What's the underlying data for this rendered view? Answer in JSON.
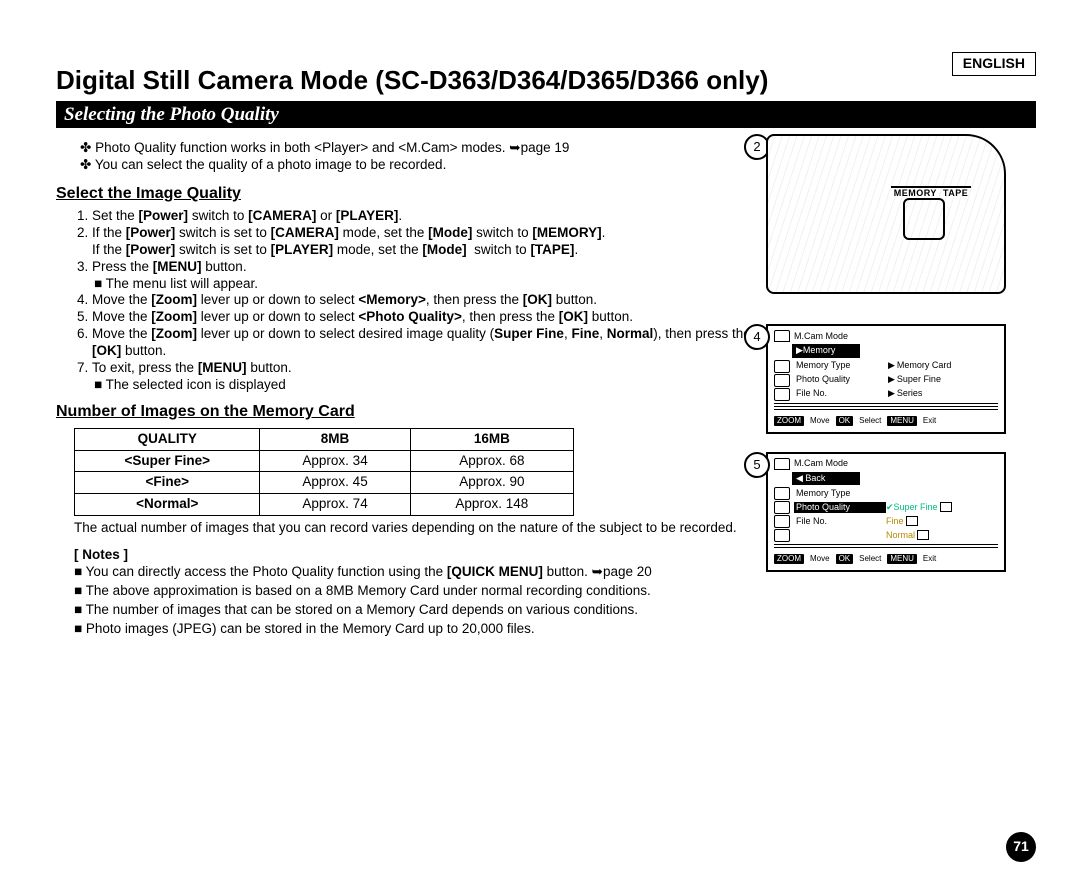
{
  "language_label": "ENGLISH",
  "title": "Digital Still Camera Mode (SC-D363/D364/D365/D366 only)",
  "section_bar": "Selecting the Photo Quality",
  "intro_bullets": [
    "Photo Quality function works in both <Player> and <M.Cam> modes. ➥page 19",
    "You can select the quality of a photo image to be recorded."
  ],
  "sub1_heading": "Select the Image Quality",
  "steps_html": [
    "Set the <b>[Power]</b> switch to <b>[CAMERA]</b> or <b>[PLAYER]</b>.",
    "If the <b>[Power]</b> switch is set to <b>[CAMERA]</b> mode, set the <b>[Mode]</b> switch to <b>[MEMORY]</b>.<br>If the <b>[Power]</b> switch is set to <b>[PLAYER]</b> mode, set the <b>[Mode]</b>&nbsp; switch to <b>[TAPE]</b>.",
    "Press the <b>[MENU]</b> button.<ul class=\"sq-sub\"><li>The menu list will appear.</li></ul>",
    "Move the <b>[Zoom]</b> lever up or down to select <b>&lt;Memory&gt;</b>, then press the <b>[OK]</b> button.",
    "Move the <b>[Zoom]</b> lever up or down to select <b>&lt;Photo Quality&gt;</b>, then press the <b>[OK]</b> button.",
    "Move the <b>[Zoom]</b> lever up or down to select desired image quality (<b>Super Fine</b>, <b>Fine</b>, <b>Normal</b>), then press the <b>[OK]</b> button.",
    "To exit, press the <b>[MENU]</b> button.<ul class=\"sq-sub\"><li>The selected icon is displayed</li></ul>"
  ],
  "sub2_heading": "Number of Images on the Memory Card",
  "table": {
    "headers": [
      "QUALITY",
      "8MB",
      "16MB"
    ],
    "rows": [
      [
        "<Super Fine>",
        "Approx. 34",
        "Approx. 68"
      ],
      [
        "<Fine>",
        "Approx. 45",
        "Approx. 90"
      ],
      [
        "<Normal>",
        "Approx. 74",
        "Approx. 148"
      ]
    ]
  },
  "table_note": "The actual number of images that you can record varies depending on the nature of the subject to be recorded.",
  "notes_heading": "[ Notes ]",
  "notes_html": [
    "You can directly access the Photo Quality function using the <b>[QUICK MENU]</b> button. ➥page 20",
    "The above approximation is based on a 8MB Memory Card under normal recording conditions.",
    "The number of images that can be stored on a Memory Card depends on various conditions.",
    "Photo images (JPEG) can be stored in the Memory Card up to 20,000 files."
  ],
  "page_number": "71",
  "fig2": {
    "step": "2",
    "switch_labels": [
      "MEMORY",
      "TAPE"
    ]
  },
  "fig4": {
    "step": "4",
    "mode": "M.Cam Mode",
    "section": "▶Memory",
    "rows": [
      {
        "left": "Memory Type",
        "right": "Memory Card"
      },
      {
        "left": "Photo Quality",
        "right": "Super Fine"
      },
      {
        "left": "File No.",
        "right": "Series"
      }
    ],
    "footer": {
      "zoom": "ZOOM",
      "move": "Move",
      "ok": "OK",
      "select": "Select",
      "menu": "MENU",
      "exit": "Exit"
    }
  },
  "fig5": {
    "step": "5",
    "mode": "M.Cam Mode",
    "section": "◀ Back",
    "rows": [
      {
        "left": "Memory Type"
      },
      {
        "left": "Photo Quality",
        "highlight": true,
        "right": "Super Fine",
        "sel": true
      },
      {
        "left": "File No.",
        "right": "Fine",
        "dim": true
      },
      {
        "right2": "Normal",
        "dim": true
      }
    ],
    "footer": {
      "zoom": "ZOOM",
      "move": "Move",
      "ok": "OK",
      "select": "Select",
      "menu": "MENU",
      "exit": "Exit"
    }
  }
}
